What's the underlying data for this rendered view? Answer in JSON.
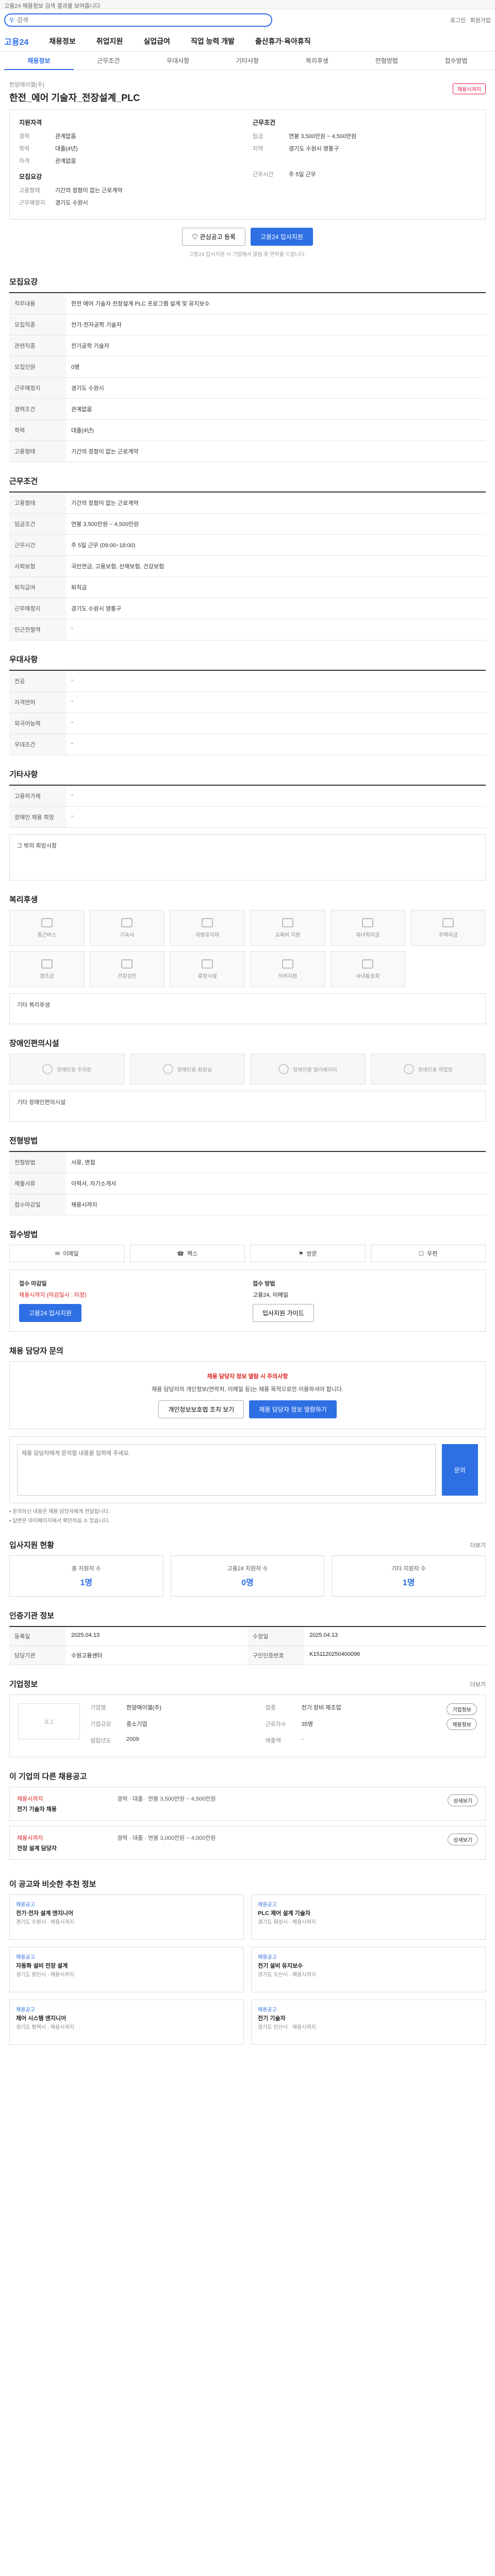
{
  "topbar": {
    "text": "고용24 채용정보 검색 결과를 보여줍니다"
  },
  "search": {
    "placeholder": "검색",
    "links": [
      "로그인",
      "회원가입"
    ]
  },
  "gnb": {
    "logo": "고용24",
    "items": [
      "채용정보",
      "취업지원",
      "실업급여",
      "직업 능력 개발",
      "출산휴가·육아휴직"
    ]
  },
  "subtabs": [
    "채용정보",
    "근무조건",
    "우대사항",
    "기타사항",
    "복리후생",
    "전형방법",
    "접수방법"
  ],
  "job": {
    "company": "한양에이엘(주)",
    "title": "한전_에어 기술자_전장설계_PLC",
    "badge": "채용시까지",
    "summary_left_title": "지원자격",
    "summary_right_title": "근무조건",
    "left_rows": [
      {
        "k": "경력",
        "v": "관계없음"
      },
      {
        "k": "학력",
        "v": "대졸(4년)"
      },
      {
        "k": "자격",
        "v": "관계없음"
      }
    ],
    "left_rows2_title": "모집요강",
    "left_rows2": [
      {
        "k": "고용형태",
        "v": "기간의 정함이 없는 근로계약"
      },
      {
        "k": "근무예정지",
        "v": "경기도 수원시"
      }
    ],
    "right_rows": [
      {
        "k": "임금",
        "v": "연봉 3,500만원 ~ 4,500만원"
      },
      {
        "k": "지역",
        "v": "경기도 수원시 영통구"
      }
    ],
    "right_rows2": [
      {
        "k": "근무시간",
        "v": "주 5일 근무"
      }
    ]
  },
  "actions": {
    "interest": "관심공고 등록",
    "apply": "고용24 입사지원"
  },
  "note": "고용24 입사지원 시 기업에서 열람 후 연락을 드립니다.",
  "sections": {
    "recruit": "모집요강",
    "conditions": "근무조건",
    "preference": "우대사항",
    "etc": "기타사항",
    "welfare": "복리후생",
    "disability": "장애인편의시설",
    "selection": "전형방법",
    "apply_method": "접수방법",
    "qa": "채용 담당자 문의",
    "stats": "입사지원 현황",
    "info": "인증기관 정보",
    "company": "기업정보",
    "other_jobs": "이 기업의 다른 채용공고",
    "recommend": "이 공고와 비슷한 추천 정보"
  },
  "recruit_rows": [
    {
      "k": "직무내용",
      "v": "한전 에어 기술자 전장설계 PLC 프로그램 설계 및 유지보수"
    },
    {
      "k": "모집직종",
      "v": "전기·전자공학 기술자"
    },
    {
      "k": "관련직종",
      "v": "전기공학 기술자"
    },
    {
      "k": "모집인원",
      "v": "0명"
    },
    {
      "k": "근무예정지",
      "v": "경기도 수원시"
    },
    {
      "k": "경력조건",
      "v": "관계없음"
    },
    {
      "k": "학력",
      "v": "대졸(4년)"
    },
    {
      "k": "고용형태",
      "v": "기간의 정함이 없는 근로계약"
    }
  ],
  "condition_rows": [
    {
      "k": "고용형태",
      "v": "기간의 정함이 없는 근로계약"
    },
    {
      "k": "임금조건",
      "v": "연봉 3,500만원 ~ 4,500만원"
    },
    {
      "k": "근무시간",
      "v": "주 5일 근무 (09:00~18:00)"
    },
    {
      "k": "사회보험",
      "v": "국민연금, 고용보험, 산재보험, 건강보험"
    },
    {
      "k": "퇴직급여",
      "v": "퇴직금"
    },
    {
      "k": "근무예정지",
      "v": "경기도 수원시 영통구"
    },
    {
      "k": "인근전철역",
      "v": "-"
    }
  ],
  "preference_rows": [
    {
      "k": "전공",
      "v": "-"
    },
    {
      "k": "자격면허",
      "v": "-"
    },
    {
      "k": "외국어능력",
      "v": "-"
    },
    {
      "k": "우대조건",
      "v": "-"
    }
  ],
  "etc_rows": [
    {
      "k": "고용허가제",
      "v": "-"
    },
    {
      "k": "장애인 채용 희망",
      "v": "-"
    }
  ],
  "etc_box": "그 밖의 희망사항",
  "welfare_items": [
    "통근버스",
    "기숙사",
    "차량유지비",
    "교육비 지원",
    "자녀학자금",
    "주택자금",
    "경조금",
    "건강검진",
    "휴양시설",
    "식비지원",
    "사내동호회"
  ],
  "welfare_note": "기타 복리후생",
  "disability_items": [
    "장애인용 주차장",
    "장애인용 화장실",
    "장애인용 엘리베이터",
    "장애인용 작업장"
  ],
  "disability_note": "기타 장애인편의시설",
  "selection_rows": [
    {
      "k": "전형방법",
      "v": "서류, 면접"
    },
    {
      "k": "제출서류",
      "v": "이력서, 자기소개서"
    },
    {
      "k": "접수마감일",
      "v": "채용시까지"
    }
  ],
  "apply_methods": [
    "이메일",
    "팩스",
    "방문",
    "우편"
  ],
  "apply_box": {
    "left_label": "접수 마감일",
    "left_value": "채용시까지 (마감일시 : 미정)",
    "left_btn": "고용24 입사지원",
    "right_label": "접수 방법",
    "right_value": "고용24, 이메일",
    "right_btn": "입사지원 가이드"
  },
  "qa_warning": {
    "title": "채용 담당자 정보 열람 시 주의사항",
    "body": "채용 담당자의 개인정보(연락처, 이메일 등)는 채용 목적으로만 이용하셔야 합니다.",
    "btn1": "개인정보보호법 조치 보기",
    "btn2": "채용 담당자 정보 열람하기"
  },
  "qa": {
    "placeholder": "채용 담당자에게 문의할 내용을 입력해 주세요.",
    "submit": "문의"
  },
  "qa_bullets": [
    "• 문의하신 내용은 채용 담당자에게 전달됩니다.",
    "• 답변은 마이페이지에서 확인하실 수 있습니다."
  ],
  "stats": [
    {
      "label": "총 지원자 수",
      "num": "1명"
    },
    {
      "label": "고용24 지원자 수",
      "num": "0명"
    },
    {
      "label": "기타 지원자 수",
      "num": "1명"
    }
  ],
  "info_rows": [
    {
      "k": "등록일",
      "v": "2025.04.13",
      "k2": "수정일",
      "v2": "2025.04.13"
    },
    {
      "k": "담당기관",
      "v": "수원고용센터",
      "k2": "구인인증번호",
      "v2": "K151120250400096"
    }
  ],
  "company_info": [
    {
      "k": "기업명",
      "v": "한양에이엘(주)"
    },
    {
      "k": "업종",
      "v": "전기 장비 제조업"
    },
    {
      "k": "기업규모",
      "v": "중소기업"
    },
    {
      "k": "근로자수",
      "v": "35명"
    },
    {
      "k": "설립년도",
      "v": "2009"
    },
    {
      "k": "매출액",
      "v": "-"
    }
  ],
  "company_logo": "로고",
  "company_btns": [
    "기업정보",
    "채용정보"
  ],
  "other_jobs": [
    {
      "tag": "채용시까지",
      "title": "전기 기술자 채용",
      "info": "경력 · 대졸 · 연봉 3,500만원 ~ 4,500만원",
      "btn": "상세보기"
    },
    {
      "tag": "채용시까지",
      "title": "전장 설계 담당자",
      "info": "경력 · 대졸 · 연봉 3,000만원 ~ 4,000만원",
      "btn": "상세보기"
    }
  ],
  "recommend": [
    {
      "tag": "채용공고",
      "title": "전기·전자 설계 엔지니어",
      "meta": "경기도 수원시 · 채용시까지"
    },
    {
      "tag": "채용공고",
      "title": "PLC 제어 설계 기술자",
      "meta": "경기도 화성시 · 채용시까지"
    },
    {
      "tag": "채용공고",
      "title": "자동화 설비 전장 설계",
      "meta": "경기도 용인시 · 채용시까지"
    },
    {
      "tag": "채용공고",
      "title": "전기 설비 유지보수",
      "meta": "경기도 오산시 · 채용시까지"
    },
    {
      "tag": "채용공고",
      "title": "제어 시스템 엔지니어",
      "meta": "경기도 평택시 · 채용시까지"
    },
    {
      "tag": "채용공고",
      "title": "전기 기술자",
      "meta": "경기도 안산시 · 채용시까지"
    }
  ],
  "more_label": "더보기"
}
